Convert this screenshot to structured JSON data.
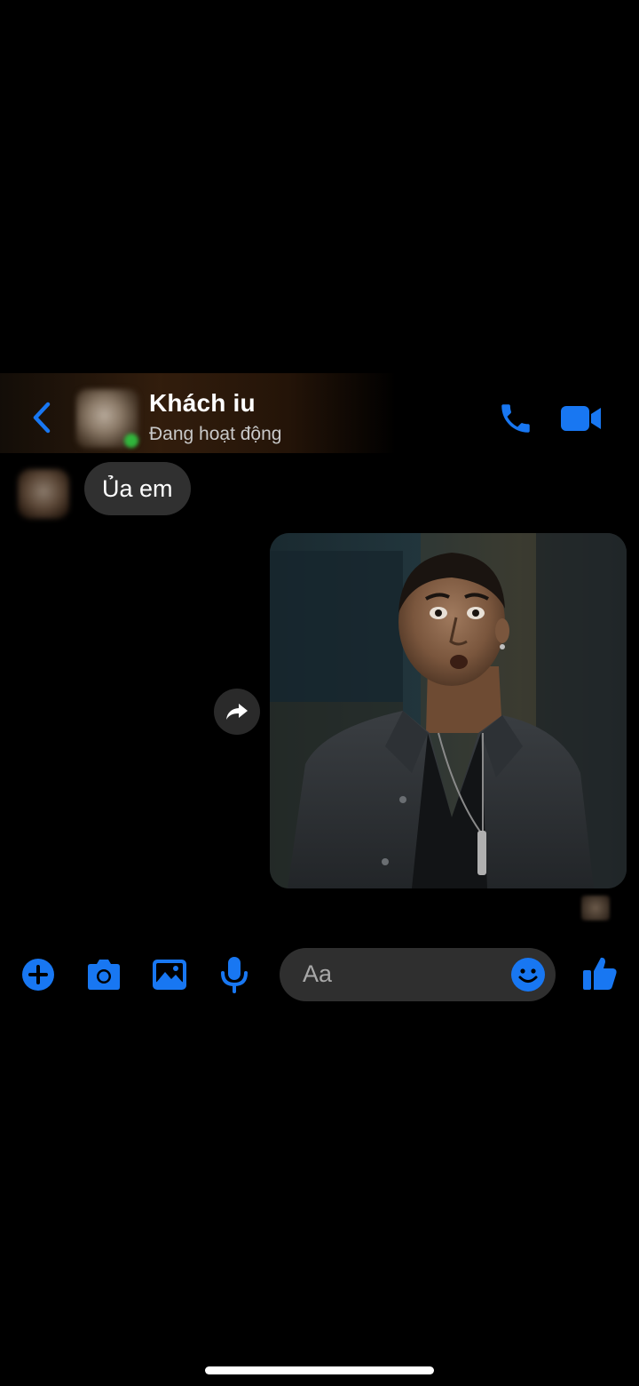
{
  "header": {
    "contact_name": "Khách iu",
    "status": "Đang hoạt động"
  },
  "messages": [
    {
      "direction": "incoming",
      "type": "text",
      "text": "Ủa em"
    },
    {
      "direction": "outgoing",
      "type": "image"
    }
  ],
  "composer": {
    "placeholder": "Aa",
    "icons": [
      "plus-icon",
      "camera-icon",
      "image-icon",
      "microphone-icon",
      "emoji-icon",
      "thumbs-up-icon"
    ]
  },
  "colors": {
    "accent": "#1877F2",
    "incoming_bubble": "#303030",
    "composer_bg": "#2F2F2F",
    "background": "#000000",
    "presence": "#2ECC40"
  }
}
